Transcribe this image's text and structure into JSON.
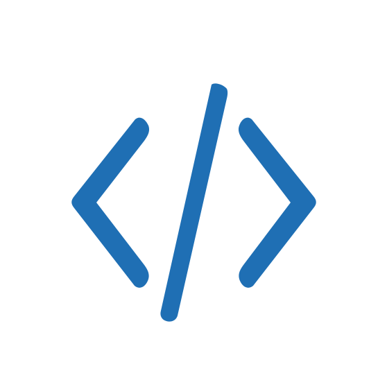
{
  "icon": {
    "name": "code-icon",
    "color": "#1F6FB4",
    "background": "#FFFFFF"
  }
}
